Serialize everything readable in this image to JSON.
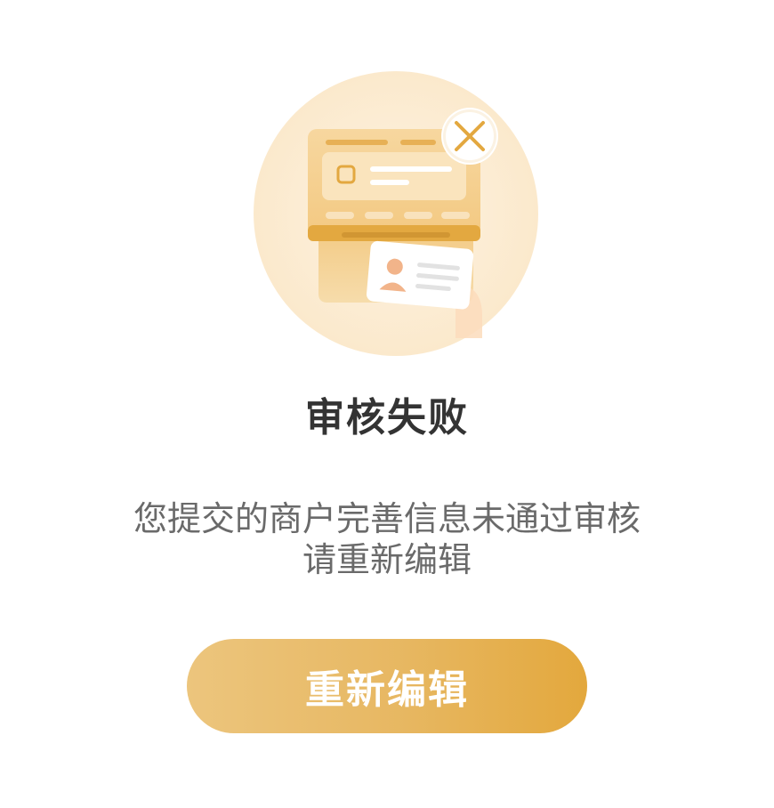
{
  "status": {
    "title": "审核失败",
    "description_line1": "您提交的商户完善信息未通过审核",
    "description_line2": "请重新编辑"
  },
  "actions": {
    "edit_again_label": "重新编辑"
  },
  "colors": {
    "accent": "#e7b761",
    "title": "#333333",
    "description": "#6a6a6a"
  },
  "icons": {
    "illustration": "pos-terminal-with-id-card-rejected",
    "close": "close-icon"
  }
}
